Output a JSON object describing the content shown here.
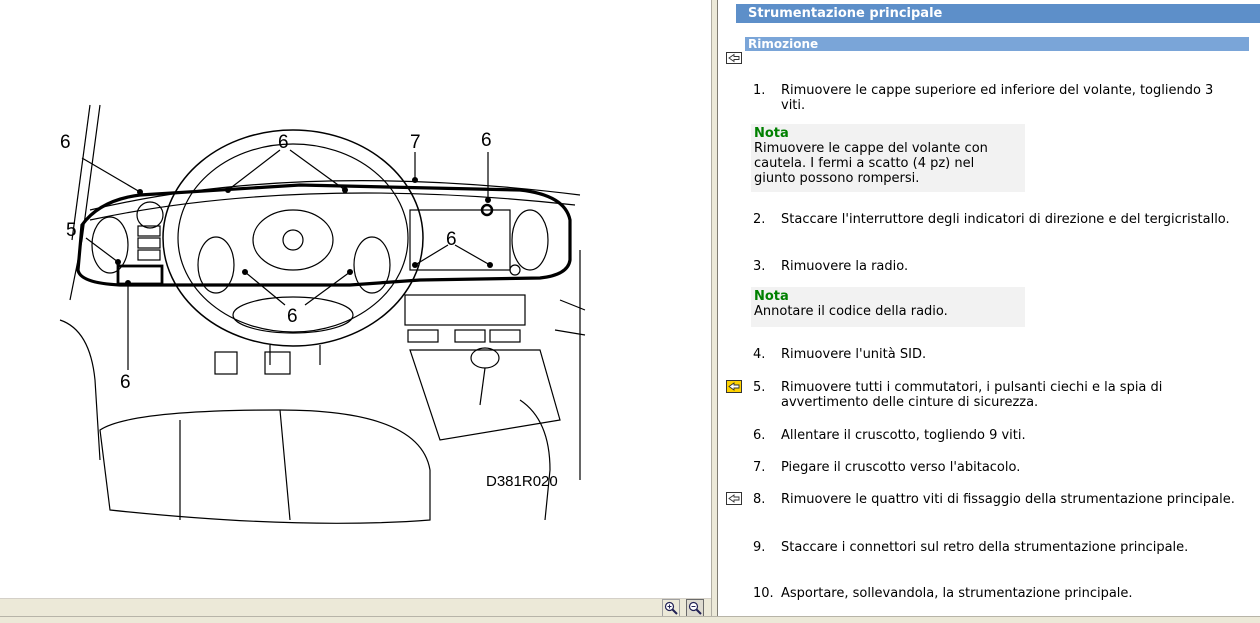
{
  "diagram": {
    "code": "D381R020",
    "callouts": [
      {
        "label": "6"
      },
      {
        "label": "6"
      },
      {
        "label": "7"
      },
      {
        "label": "6"
      },
      {
        "label": "5"
      },
      {
        "label": "6"
      },
      {
        "label": "6"
      },
      {
        "label": "6"
      }
    ]
  },
  "zoom": {
    "zoom_in_icon": "zoom-in-icon",
    "zoom_out_icon": "zoom-out-icon"
  },
  "doc": {
    "title": "Strumentazione principale",
    "section": "Rimozione",
    "steps": [
      {
        "num": "1.",
        "text": "Rimuovere le cappe superiore ed inferiore del volante, togliendo 3 viti."
      },
      {
        "num": "2.",
        "text": "Staccare l'interruttore degli indicatori di direzione e del tergicristallo."
      },
      {
        "num": "3.",
        "text": "Rimuovere la radio."
      },
      {
        "num": "4.",
        "text": "Rimuovere l'unità SID."
      },
      {
        "num": "5.",
        "text": "Rimuovere tutti i commutatori, i pulsanti ciechi e la spia di avvertimento delle cinture di sicurezza."
      },
      {
        "num": "6.",
        "text": "Allentare il cruscotto, togliendo 9 viti."
      },
      {
        "num": "7.",
        "text": "Piegare il cruscotto verso l'abitacolo."
      },
      {
        "num": "8.",
        "text": "Rimuovere le quattro viti di fissaggio della strumentazione principale."
      },
      {
        "num": "9.",
        "text": "Staccare i connettori sul retro della strumentazione principale."
      },
      {
        "num": "10.",
        "text": "Asportare, sollevandola, la strumentazione principale."
      }
    ],
    "notes": [
      {
        "title": "Nota",
        "text": "Rimuovere le cappe del volante con cautela. I fermi a scatto (4 pz) nel giunto possono rompersi."
      },
      {
        "title": "Nota",
        "text": "Annotare il codice della radio."
      }
    ],
    "colors": {
      "title_bar": "#5d8fc9",
      "section_bar": "#7aa5d8",
      "note_title": "#008000",
      "note_bg": "#f2f2f2"
    }
  }
}
